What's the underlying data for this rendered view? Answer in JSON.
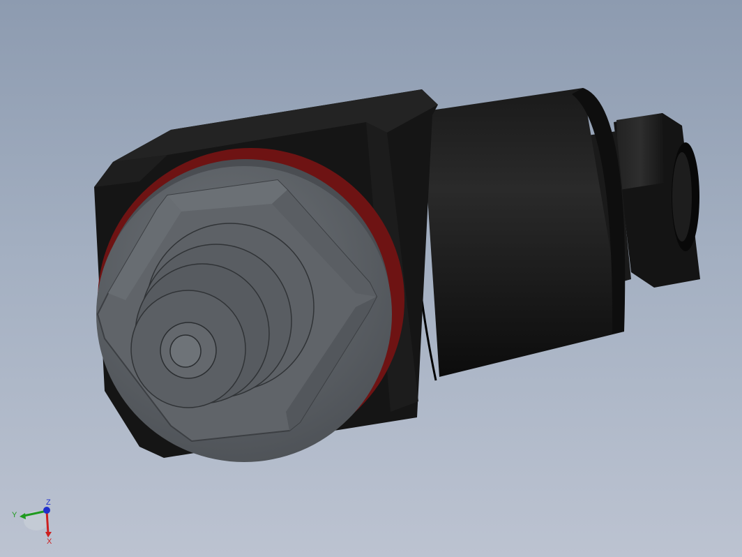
{
  "triad": {
    "z_label": "Z",
    "y_label": "Y",
    "x_label": "X",
    "x_color": "#cc1f1f",
    "y_color": "#1f9a1f",
    "z_color": "#1f2fcc"
  },
  "model": {
    "body_color": "#141414",
    "fitting_color": "#5a5e63",
    "seal_color": "#7a1414",
    "background_top": "#8d9bb0",
    "background_bottom": "#bcc3d1"
  }
}
